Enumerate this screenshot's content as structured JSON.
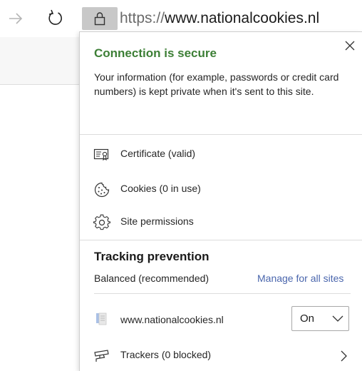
{
  "toolbar": {
    "url_scheme": "https://",
    "url_host": "www.nationalcookies.nl"
  },
  "flyout": {
    "title": "Connection is secure",
    "description": "Your information (for example, passwords or credit card numbers) is kept private when it's sent to this site.",
    "title_color": "#3d7f36",
    "items": [
      {
        "label": "Certificate (valid)",
        "icon": "certificate-icon"
      },
      {
        "label": "Cookies (0 in use)",
        "icon": "cookie-icon"
      },
      {
        "label": "Site permissions",
        "icon": "gear-icon"
      }
    ],
    "tracking": {
      "title": "Tracking prevention",
      "level": "Balanced (recommended)",
      "manage_link": "Manage for all sites",
      "link_color": "#4a66ad",
      "site": "www.nationalcookies.nl",
      "site_toggle": "On",
      "trackers": "Trackers (0 blocked)"
    }
  }
}
